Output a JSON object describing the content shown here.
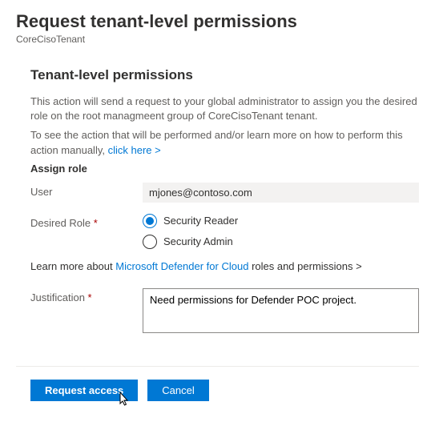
{
  "header": {
    "title": "Request tenant-level permissions",
    "tenant": "CoreCisoTenant"
  },
  "section": {
    "heading": "Tenant-level permissions",
    "description_line1": "This action will send a request to your global administrator to assign you the desired role on the root managmeent group of CoreCisoTenant tenant.",
    "description_line2": "To see the action that will be performed and/or learn more on how to perform this action manually,",
    "click_here": "click here >"
  },
  "form": {
    "assign_role_label": "Assign role",
    "user_label": "User",
    "user_value": "mjones@contoso.com",
    "desired_role_label": "Desired Role",
    "role_options": [
      {
        "label": "Security Reader",
        "selected": true
      },
      {
        "label": "Security Admin",
        "selected": false
      }
    ],
    "learn_more_prefix": "Learn more about",
    "learn_more_link": "Microsoft Defender for Cloud",
    "learn_more_suffix": "roles and permissions >",
    "justification_label": "Justification",
    "justification_value": "Need permissions for Defender POC project."
  },
  "footer": {
    "request_access": "Request access",
    "cancel": "Cancel"
  }
}
